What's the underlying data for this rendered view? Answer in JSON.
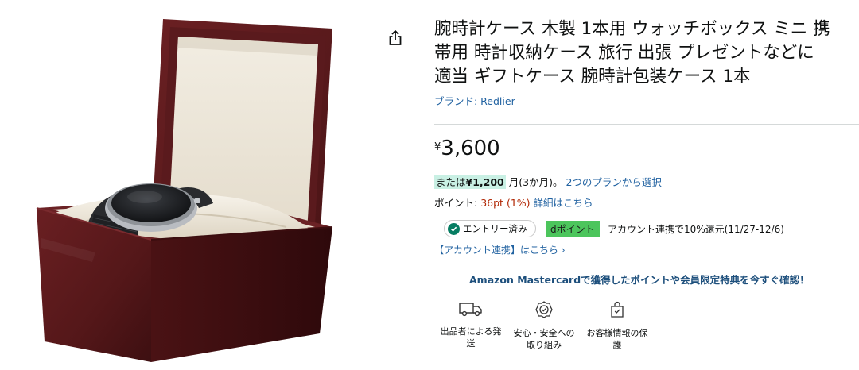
{
  "product": {
    "title_lines": [
      "腕時計ケース 木製 1本用 ウォッチボックス ミニ 携",
      "帯用 時計収納ケース 旅行 出張 プレゼントなどに",
      "適当 ギフトケース 腕時計包装ケース 1本"
    ],
    "brand_label": "ブランド: Redlier"
  },
  "price": {
    "symbol": "¥",
    "amount": "3,600"
  },
  "installment": {
    "prefix": "または",
    "amount": "¥1,200",
    "suffix": "月(3か月)。",
    "plans_link": "2つのプランから選択"
  },
  "points": {
    "label": "ポイント:",
    "value": "36pt",
    "percent": "(1%)",
    "details_link": "詳細はこちら"
  },
  "promo": {
    "entry_label": "エントリー済み",
    "dpoint_label": "dポイント",
    "text": "アカウント連携で10%還元(11/27-12/6)",
    "account_link": "【アカウント連携】はこちら ›"
  },
  "mastercard_banner": "Amazon Mastercardで獲得したポイントや会員限定特典を今すぐ確認！",
  "features": [
    {
      "icon": "delivery-truck-icon",
      "label_lines": [
        "出品者による発",
        "送"
      ]
    },
    {
      "icon": "safety-badge-icon",
      "label_lines": [
        "安心・安全への",
        "取り組み"
      ]
    },
    {
      "icon": "secure-bag-icon",
      "label_lines": [
        "お客様情報の保",
        "護"
      ]
    }
  ],
  "colors": {
    "link": "#2162a1",
    "price_red": "#b12704",
    "installment_highlight": "#c9f0e4",
    "entry_check": "#067d62",
    "dpoint_green": "#4cc55c",
    "box_wood": "#5e1a1d",
    "box_lining": "#efe9dc"
  }
}
